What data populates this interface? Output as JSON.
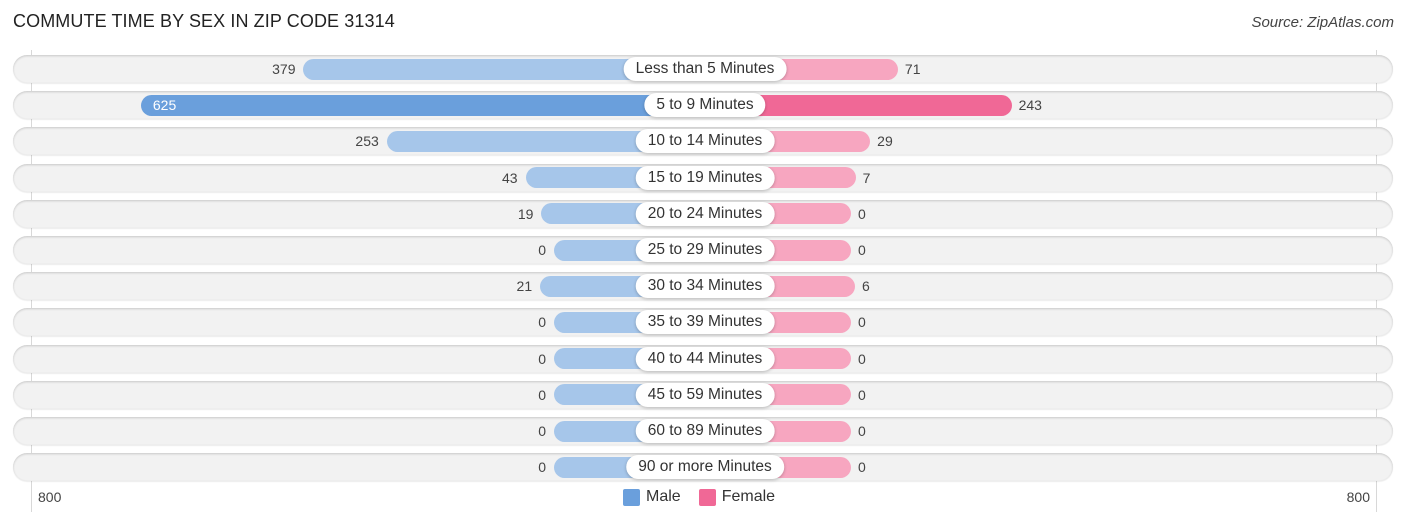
{
  "title": "COMMUTE TIME BY SEX IN ZIP CODE 31314",
  "source": "Source: ZipAtlas.com",
  "colors": {
    "male_light": "#a6c6ea",
    "male_strong": "#6a9fdc",
    "female_light": "#f7a6c0",
    "female_strong": "#f06896",
    "legend_male": "#6a9fdc",
    "legend_female": "#f06896"
  },
  "chart_data": {
    "type": "bar",
    "orientation": "horizontal-diverging",
    "title": "COMMUTE TIME BY SEX IN ZIP CODE 31314",
    "categories": [
      "Less than 5 Minutes",
      "5 to 9 Minutes",
      "10 to 14 Minutes",
      "15 to 19 Minutes",
      "20 to 24 Minutes",
      "25 to 29 Minutes",
      "30 to 34 Minutes",
      "35 to 39 Minutes",
      "40 to 44 Minutes",
      "45 to 59 Minutes",
      "60 to 89 Minutes",
      "90 or more Minutes"
    ],
    "series": [
      {
        "name": "Male",
        "values": [
          379,
          625,
          253,
          43,
          19,
          0,
          21,
          0,
          0,
          0,
          0,
          0
        ]
      },
      {
        "name": "Female",
        "values": [
          71,
          243,
          29,
          7,
          0,
          0,
          6,
          0,
          0,
          0,
          0,
          0
        ]
      }
    ],
    "axis": {
      "left_tick": "800",
      "right_tick": "800",
      "range": [
        0,
        800
      ]
    },
    "legend": {
      "position": "bottom-center",
      "entries": [
        "Male",
        "Female"
      ]
    },
    "xlabel": "",
    "ylabel": ""
  }
}
